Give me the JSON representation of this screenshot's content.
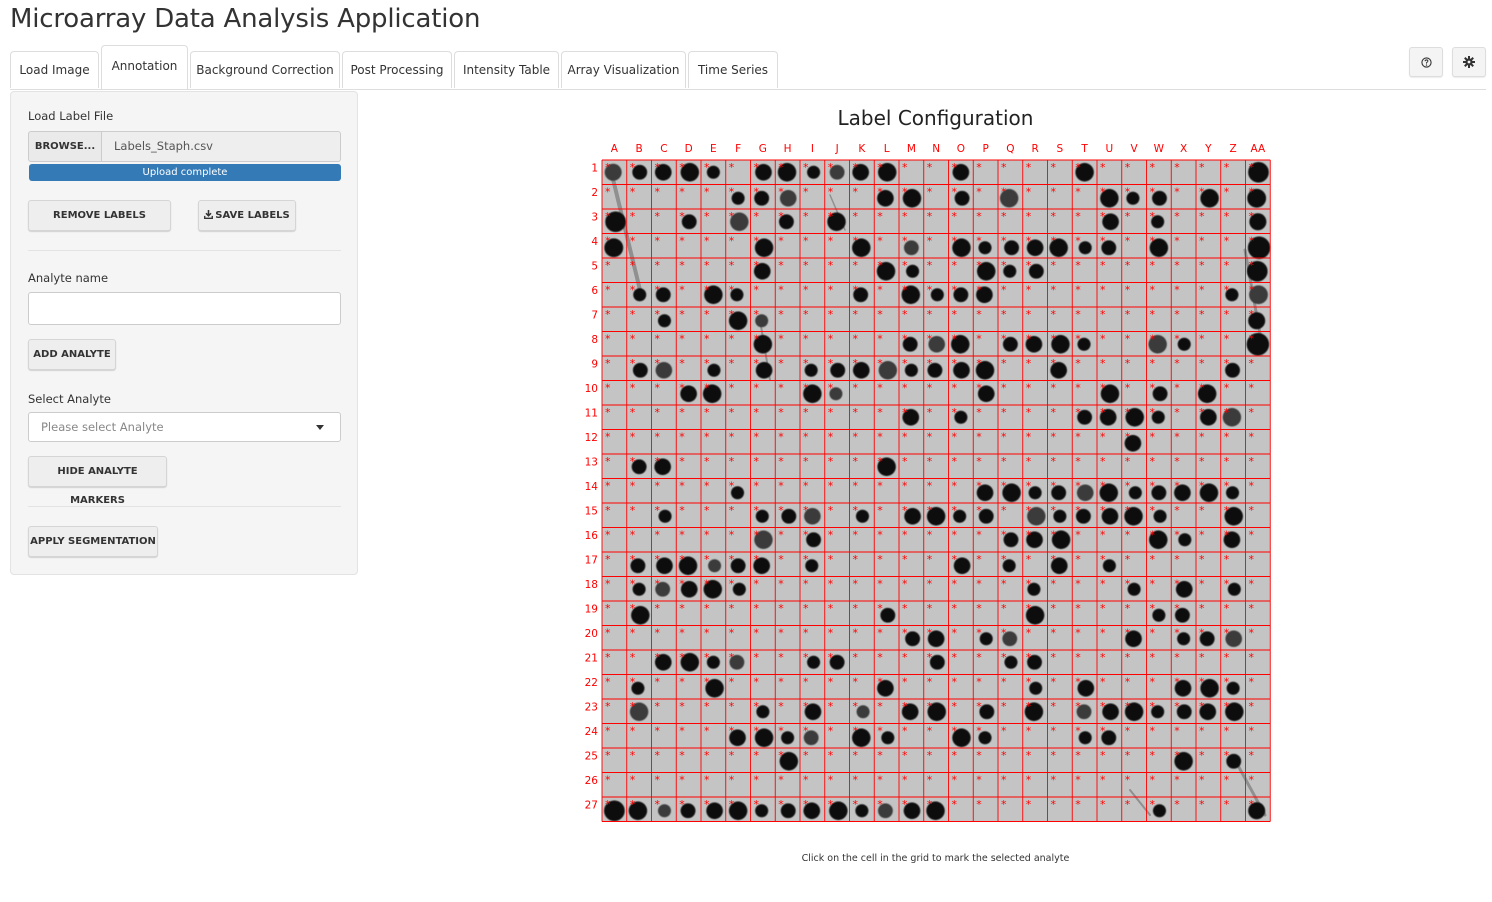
{
  "app": {
    "title": "Microarray Data Analysis Application"
  },
  "tabs": [
    {
      "label": "Load Image",
      "active": false
    },
    {
      "label": "Annotation",
      "active": true
    },
    {
      "label": "Background Correction",
      "active": false
    },
    {
      "label": "Post Processing",
      "active": false
    },
    {
      "label": "Intensity Table",
      "active": false
    },
    {
      "label": "Array Visualization",
      "active": false
    },
    {
      "label": "Time Series",
      "active": false
    }
  ],
  "header_icons": {
    "help": "question-circle-icon",
    "settings": "gear-icon"
  },
  "sidebar": {
    "load_label_file": "Load Label File",
    "browse_label": "BROWSE...",
    "file_name": "Labels_Staph.csv",
    "upload_status": "Upload complete",
    "upload_progress": 1.0,
    "remove_labels": "REMOVE LABELS",
    "save_labels": "SAVE LABELS",
    "analyte_name_label": "Analyte name",
    "analyte_name_value": "",
    "add_analyte": "ADD ANALYTE",
    "select_analyte_label": "Select Analyte",
    "select_analyte_placeholder": "Please select Analyte",
    "hide_markers": "HIDE ANALYTE MARKERS",
    "apply_segmentation": "APPLY SEGMENTATION"
  },
  "plot": {
    "title": "Label Configuration",
    "columns": [
      "A",
      "B",
      "C",
      "D",
      "E",
      "F",
      "G",
      "H",
      "I",
      "J",
      "K",
      "L",
      "M",
      "N",
      "O",
      "P",
      "Q",
      "R",
      "S",
      "T",
      "U",
      "V",
      "W",
      "X",
      "Y",
      "Z",
      "AA"
    ],
    "rows": [
      "1",
      "2",
      "3",
      "4",
      "5",
      "6",
      "7",
      "8",
      "9",
      "10",
      "11",
      "12",
      "13",
      "14",
      "15",
      "16",
      "17",
      "18",
      "19",
      "20",
      "21",
      "22",
      "23",
      "24",
      "25",
      "26",
      "27"
    ],
    "marker": "*",
    "grid_color": "#ff0000",
    "background": "#c4c4c4",
    "caption": "Click on the cell in the grid to mark the selected analyte"
  }
}
